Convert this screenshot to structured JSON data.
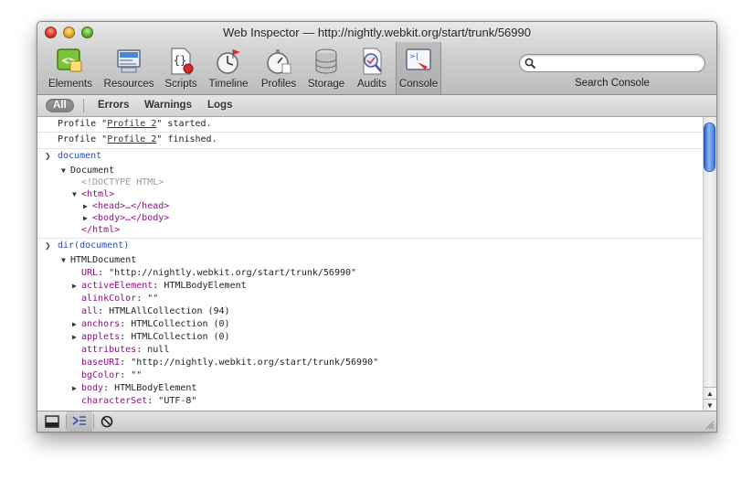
{
  "window": {
    "title": "Web Inspector — http://nightly.webkit.org/start/trunk/56990"
  },
  "toolbar": {
    "tools": [
      {
        "name": "elements",
        "label": "Elements",
        "icon": "elements-icon"
      },
      {
        "name": "resources",
        "label": "Resources",
        "icon": "resources-icon"
      },
      {
        "name": "scripts",
        "label": "Scripts",
        "icon": "scripts-icon"
      },
      {
        "name": "timeline",
        "label": "Timeline",
        "icon": "timeline-icon"
      },
      {
        "name": "profiles",
        "label": "Profiles",
        "icon": "profiles-icon"
      },
      {
        "name": "storage",
        "label": "Storage",
        "icon": "storage-icon"
      },
      {
        "name": "audits",
        "label": "Audits",
        "icon": "audits-icon"
      },
      {
        "name": "console",
        "label": "Console",
        "icon": "console-icon",
        "selected": true
      }
    ],
    "search": {
      "label": "Search Console",
      "value": "",
      "placeholder": ""
    }
  },
  "filters": {
    "all": "All",
    "errors": "Errors",
    "warnings": "Warnings",
    "logs": "Logs",
    "selected": "All"
  },
  "console": {
    "profile_messages": [
      {
        "before": "Profile \"",
        "link": "Profile 2",
        "after": "\" started."
      },
      {
        "before": "Profile \"",
        "link": "Profile 2",
        "after": "\" finished."
      }
    ],
    "command1": "document",
    "document_tree": {
      "root": "Document",
      "doctype": "<!DOCTYPE HTML>",
      "html_open": "<html>",
      "head": "<head>…</head>",
      "body": "<body>…</body>",
      "html_close": "</html>"
    },
    "command2": "dir(document)",
    "dir_root": "HTMLDocument",
    "properties": [
      {
        "key": "URL",
        "value": "\"http://nightly.webkit.org/start/trunk/56990\"",
        "expandable": false
      },
      {
        "key": "activeElement",
        "value": "HTMLBodyElement",
        "expandable": true
      },
      {
        "key": "alinkColor",
        "value": "\"\"",
        "expandable": false
      },
      {
        "key": "all",
        "value": "HTMLAllCollection (94)",
        "expandable": false
      },
      {
        "key": "anchors",
        "value": "HTMLCollection (0)",
        "expandable": true
      },
      {
        "key": "applets",
        "value": "HTMLCollection (0)",
        "expandable": true
      },
      {
        "key": "attributes",
        "value": "null",
        "expandable": false
      },
      {
        "key": "baseURI",
        "value": "\"http://nightly.webkit.org/start/trunk/56990\"",
        "expandable": false
      },
      {
        "key": "bgColor",
        "value": "\"\"",
        "expandable": false
      },
      {
        "key": "body",
        "value": "HTMLBodyElement",
        "expandable": true
      },
      {
        "key": "characterSet",
        "value": "\"UTF-8\"",
        "expandable": false
      }
    ]
  },
  "statusbar": {
    "buttons": [
      "dock-icon",
      "console-prompt-icon",
      "clear-icon"
    ]
  },
  "colors": {
    "accent": "#2a4fb3",
    "property": "#881280",
    "scroll_thumb": "#3d76d6"
  }
}
